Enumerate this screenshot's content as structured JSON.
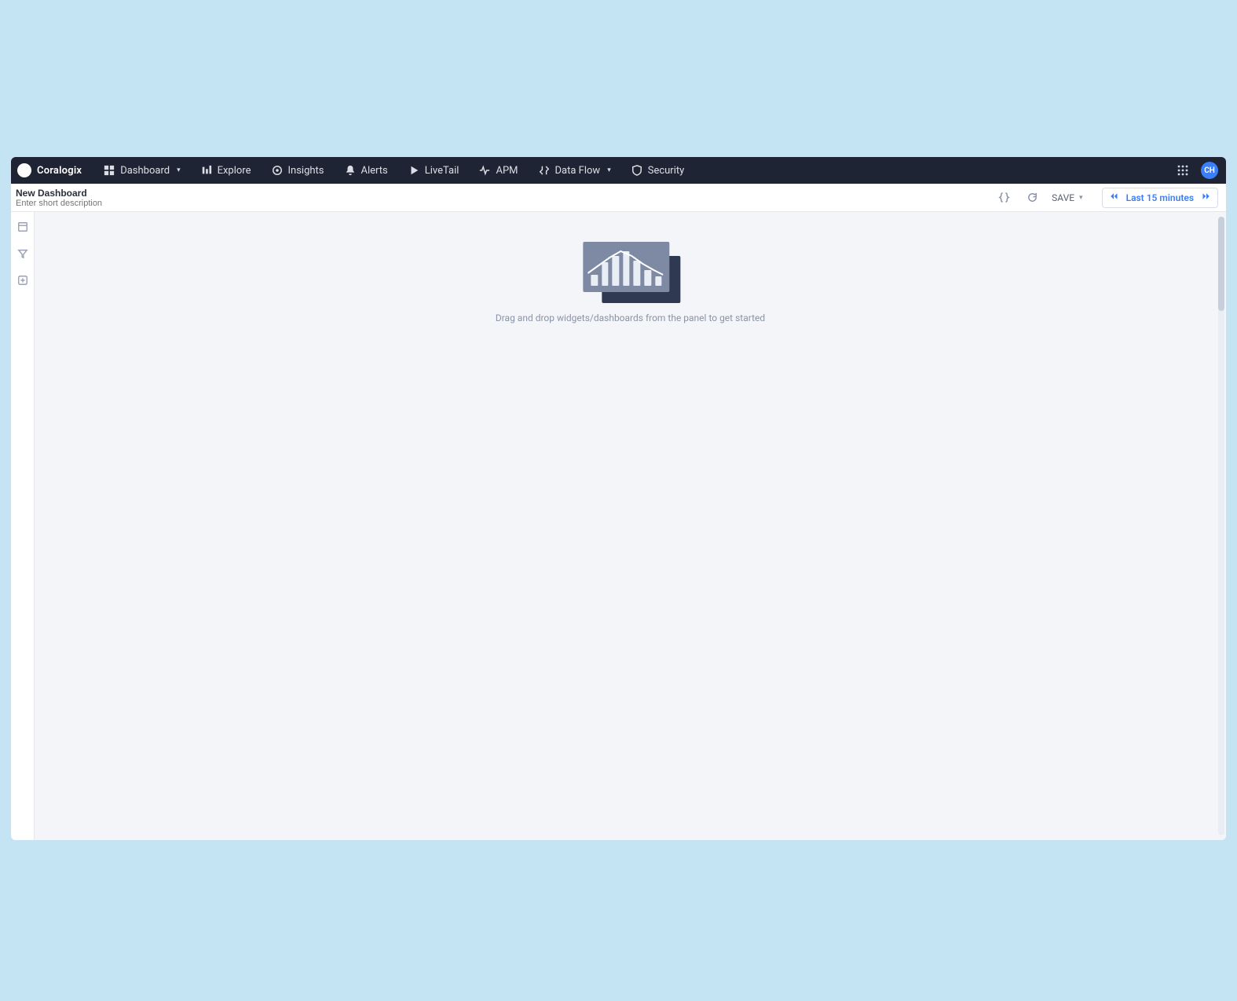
{
  "brand": {
    "name": "Coralogix"
  },
  "nav": {
    "items": [
      {
        "label": "Dashboard",
        "has_caret": true
      },
      {
        "label": "Explore"
      },
      {
        "label": "Insights"
      },
      {
        "label": "Alerts"
      },
      {
        "label": "LiveTail"
      },
      {
        "label": "APM"
      },
      {
        "label": "Data Flow",
        "has_caret": true
      },
      {
        "label": "Security"
      }
    ],
    "avatar_initials": "CH"
  },
  "subheader": {
    "title_value": "New Dashboard",
    "description_placeholder": "Enter short description",
    "save_label": "SAVE",
    "timerange_label": "Last 15 minutes"
  },
  "canvas": {
    "empty_message": "Drag and drop widgets/dashboards from the panel to get started"
  }
}
